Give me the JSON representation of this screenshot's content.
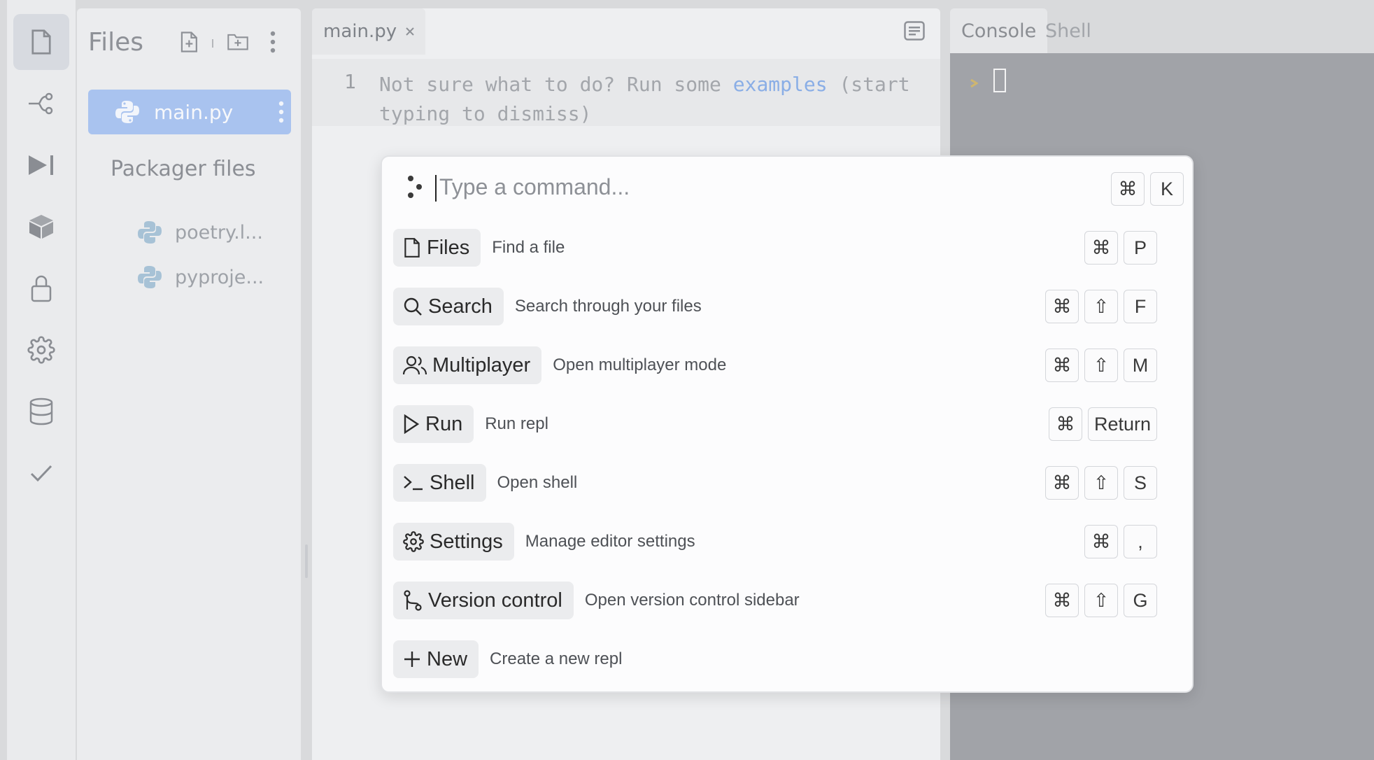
{
  "files_panel": {
    "title": "Files",
    "selected_file": "main.py",
    "packager_title": "Packager files",
    "packager_files": [
      "poetry.l...",
      "pyproje..."
    ]
  },
  "editor": {
    "tab_label": "main.py",
    "line_number": "1",
    "hint_before": "Not sure what to do? Run some ",
    "hint_link": "examples",
    "hint_after": " (start typing to dismiss)"
  },
  "right_pane": {
    "tabs": [
      "Console",
      "Shell"
    ]
  },
  "palette": {
    "placeholder": "Type a command...",
    "open_shortcut": [
      "⌘",
      "K"
    ],
    "commands": [
      {
        "label": "Files",
        "desc": "Find a file",
        "keys": [
          "⌘",
          "P"
        ],
        "icon": "file-icon"
      },
      {
        "label": "Search",
        "desc": "Search through your files",
        "keys": [
          "⌘",
          "⇧",
          "F"
        ],
        "icon": "search-icon"
      },
      {
        "label": "Multiplayer",
        "desc": "Open multiplayer mode",
        "keys": [
          "⌘",
          "⇧",
          "M"
        ],
        "icon": "users-icon"
      },
      {
        "label": "Run",
        "desc": "Run repl",
        "keys": [
          "⌘",
          "Return"
        ],
        "icon": "play-icon"
      },
      {
        "label": "Shell",
        "desc": "Open shell",
        "keys": [
          "⌘",
          "⇧",
          "S"
        ],
        "icon": "terminal-icon"
      },
      {
        "label": "Settings",
        "desc": "Manage editor settings",
        "keys": [
          "⌘",
          ","
        ],
        "icon": "gear-icon"
      },
      {
        "label": "Version control",
        "desc": "Open version control sidebar",
        "keys": [
          "⌘",
          "⇧",
          "G"
        ],
        "icon": "git-branch-icon"
      },
      {
        "label": "New",
        "desc": "Create a new repl",
        "keys": [],
        "icon": "plus-icon"
      }
    ]
  }
}
